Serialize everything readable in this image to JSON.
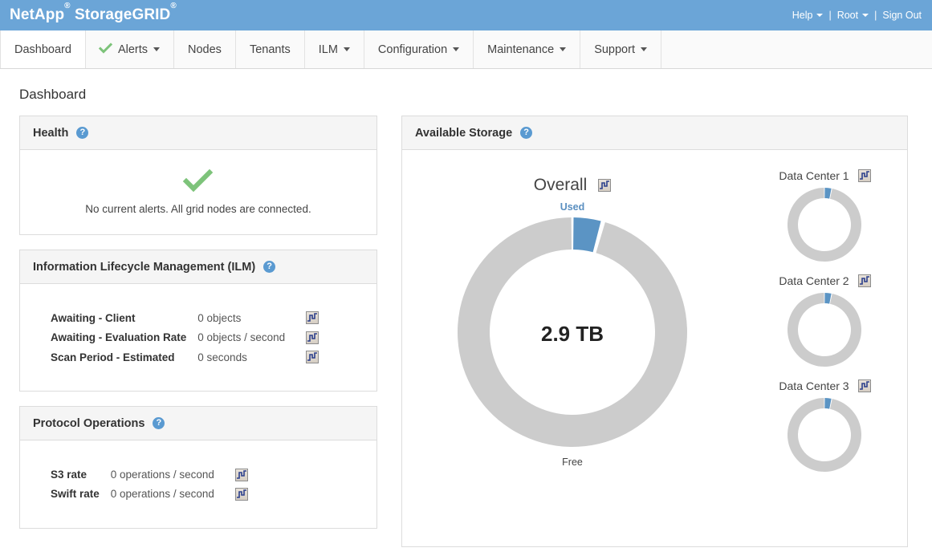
{
  "brand": {
    "name_netapp": "NetApp",
    "sup1": "®",
    "name_product": "StorageGRID",
    "sup2": "®",
    "color": "#6ba5d7"
  },
  "topnav_right": {
    "help": "Help",
    "sep1": "|",
    "user": "Root",
    "sep2": "|",
    "signout": "Sign Out"
  },
  "nav": {
    "tabs": [
      {
        "label": "Dashboard",
        "icon": null,
        "caret": false,
        "active": true
      },
      {
        "label": "Alerts",
        "icon": "green-check-icon",
        "caret": true,
        "active": false
      },
      {
        "label": "Nodes",
        "icon": null,
        "caret": false,
        "active": false
      },
      {
        "label": "Tenants",
        "icon": null,
        "caret": false,
        "active": false
      },
      {
        "label": "ILM",
        "icon": null,
        "caret": true,
        "active": false
      },
      {
        "label": "Configuration",
        "icon": null,
        "caret": true,
        "active": false
      },
      {
        "label": "Maintenance",
        "icon": null,
        "caret": true,
        "active": false
      },
      {
        "label": "Support",
        "icon": null,
        "caret": true,
        "active": false
      }
    ]
  },
  "page": {
    "title": "Dashboard"
  },
  "health": {
    "title": "Health",
    "help": "?",
    "status_icon": "green-check-icon",
    "message": "No current alerts. All grid nodes are connected."
  },
  "ilm": {
    "title": "Information Lifecycle Management (ILM)",
    "help": "?",
    "rows": [
      {
        "label": "Awaiting - Client",
        "value": "0 objects",
        "icon": "chart-icon"
      },
      {
        "label": "Awaiting - Evaluation Rate",
        "value": "0 objects / second",
        "icon": "chart-icon"
      },
      {
        "label": "Scan Period - Estimated",
        "value": "0 seconds",
        "icon": "chart-icon"
      }
    ]
  },
  "protocol": {
    "title": "Protocol Operations",
    "help": "?",
    "rows": [
      {
        "label": "S3 rate",
        "value": "0 operations / second",
        "icon": "chart-icon"
      },
      {
        "label": "Swift rate",
        "value": "0 operations / second",
        "icon": "chart-icon"
      }
    ]
  },
  "storage": {
    "title": "Available Storage",
    "help": "?",
    "overall": {
      "label": "Overall",
      "icon": "chart-icon",
      "used_label": "Used",
      "free_label": "Free",
      "center_value": "2.9 TB"
    },
    "data_centers": [
      {
        "name": "Data Center 1",
        "icon": "chart-icon"
      },
      {
        "name": "Data Center 2",
        "icon": "chart-icon"
      },
      {
        "name": "Data Center 3",
        "icon": "chart-icon"
      }
    ]
  },
  "chart_data": [
    {
      "type": "pie",
      "title": "Overall",
      "center_label": "2.9 TB",
      "labels": [
        "Used",
        "Free"
      ],
      "values": [
        4,
        96
      ],
      "unit": "%",
      "colors": [
        "#5b94c4",
        "#cccccc"
      ],
      "legend": "annotations: Used (top), Free (bottom)"
    },
    {
      "type": "pie",
      "title": "Data Center 1",
      "labels": [
        "Used",
        "Free"
      ],
      "values": [
        3,
        97
      ],
      "unit": "%",
      "colors": [
        "#5b94c4",
        "#cccccc"
      ]
    },
    {
      "type": "pie",
      "title": "Data Center 2",
      "labels": [
        "Used",
        "Free"
      ],
      "values": [
        3,
        97
      ],
      "unit": "%",
      "colors": [
        "#5b94c4",
        "#cccccc"
      ]
    },
    {
      "type": "pie",
      "title": "Data Center 3",
      "labels": [
        "Used",
        "Free"
      ],
      "values": [
        3,
        97
      ],
      "unit": "%",
      "colors": [
        "#5b94c4",
        "#cccccc"
      ]
    }
  ]
}
